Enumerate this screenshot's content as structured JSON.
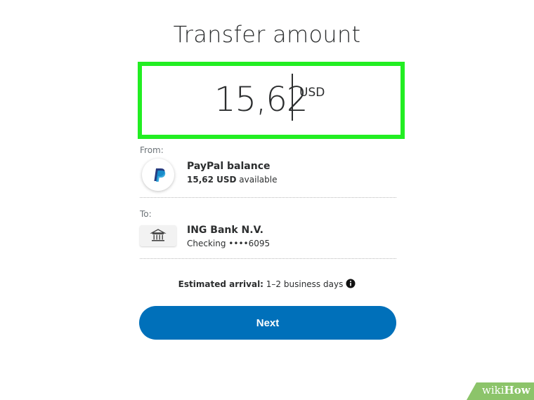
{
  "title": "Transfer amount",
  "amount": {
    "value": "15,62",
    "currency": "USD"
  },
  "from": {
    "label": "From:",
    "name": "PayPal balance",
    "amount_bold": "15,62 USD",
    "amount_suffix": " available",
    "icon": "paypal-logo-icon"
  },
  "to": {
    "label": "To:",
    "name": "ING Bank N.V.",
    "account": "Checking ••••6095",
    "icon": "bank-icon"
  },
  "arrival": {
    "label": "Estimated arrival:",
    "value": " 1–2 business days",
    "icon": "info-icon"
  },
  "next_button": {
    "label": "Next"
  },
  "watermark": {
    "wiki": "wiki",
    "how": "How"
  },
  "colors": {
    "highlight": "#22ee22",
    "primary": "#0070ba",
    "paypal_dark": "#253b80",
    "paypal_light": "#179bd7",
    "watermark": "#8cc46a"
  }
}
